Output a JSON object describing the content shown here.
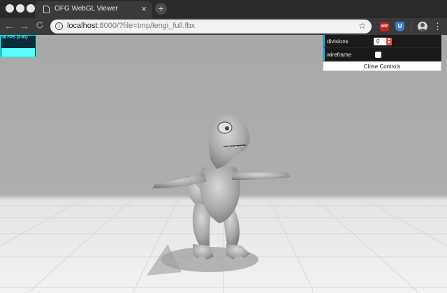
{
  "browser": {
    "tab": {
      "title": "OFG WebGL Viewer",
      "close": "×"
    },
    "new_tab": "+",
    "nav": {
      "back": "←",
      "forward": "→",
      "reload": "C"
    },
    "address": {
      "host": "localhost",
      "rest": ":8000/?file=tmp/lengi_full.fbx"
    },
    "bookmark": "☆",
    "extensions": [
      "ABP",
      "U"
    ],
    "menu": "⋮"
  },
  "stats": {
    "fps_text": "59 FPS (3-61)"
  },
  "controls": {
    "rows": [
      {
        "label": "divisions",
        "value": "0"
      },
      {
        "label": "wireframe",
        "checked": false
      }
    ],
    "close_label": "Close Controls"
  },
  "colors": {
    "accent": "#2fa1d6",
    "stats_fg": "#55ffff",
    "stats_bg": "#0a2b3a",
    "spinner": "#e05050"
  }
}
